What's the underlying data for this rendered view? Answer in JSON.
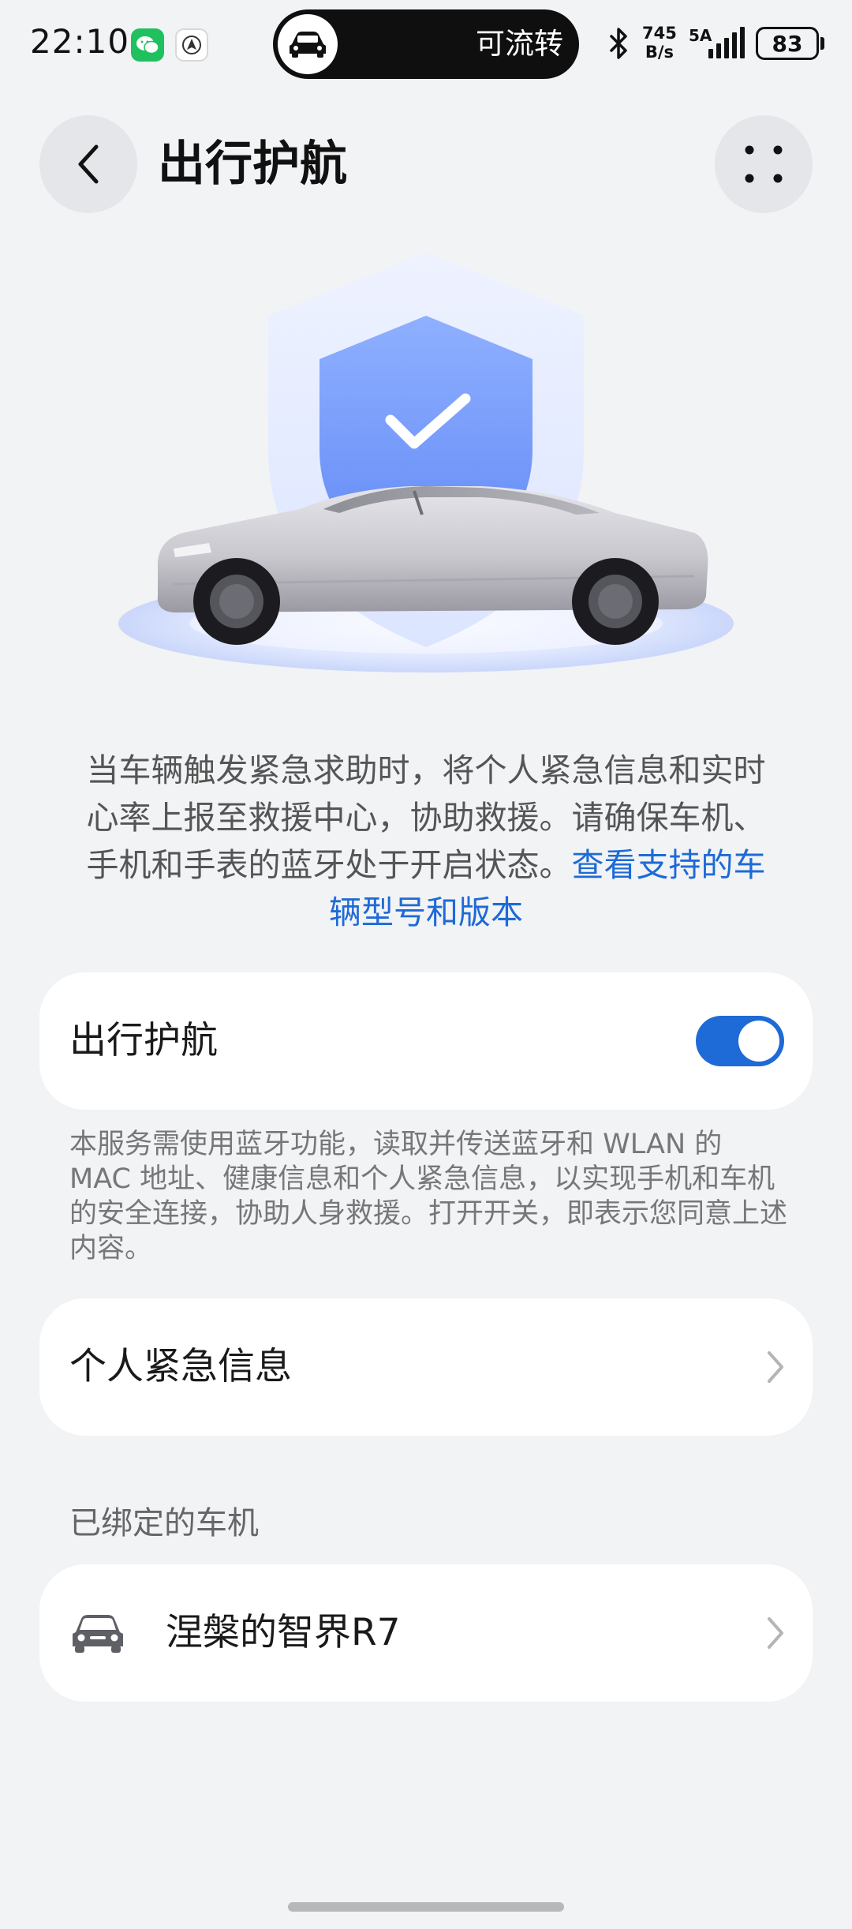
{
  "status_bar": {
    "time": "22:10",
    "live_activity_text": "可流转",
    "net_speed_value": "745",
    "net_speed_unit": "B/s",
    "signal_label": "5A",
    "battery_level": "83"
  },
  "header": {
    "title": "出行护航",
    "back_icon": "chevron-left-icon",
    "more_icon": "four-dots-icon"
  },
  "description": {
    "text": "当车辆触发紧急求助时，将个人紧急信息和实时心率上报至救援中心，协助救援。请确保车机、手机和手表的蓝牙处于开启状态。",
    "link_text": "查看支持的车辆型号和版本"
  },
  "toggle_card": {
    "label": "出行护航",
    "enabled": true
  },
  "notice": {
    "text": "本服务需使用蓝牙功能，读取并传送蓝牙和 WLAN 的 MAC 地址、健康信息和个人紧急信息，以实现手机和车机的安全连接，协助人身救援。打开开关，即表示您同意上述内容。"
  },
  "emergency_card": {
    "label": "个人紧急信息"
  },
  "bound_section": {
    "title": "已绑定的车机"
  },
  "vehicle_card": {
    "name": "涅槃的智界R7"
  },
  "colors": {
    "accent": "#1e6ad6",
    "background": "#f1f3f5",
    "card": "#ffffff"
  }
}
